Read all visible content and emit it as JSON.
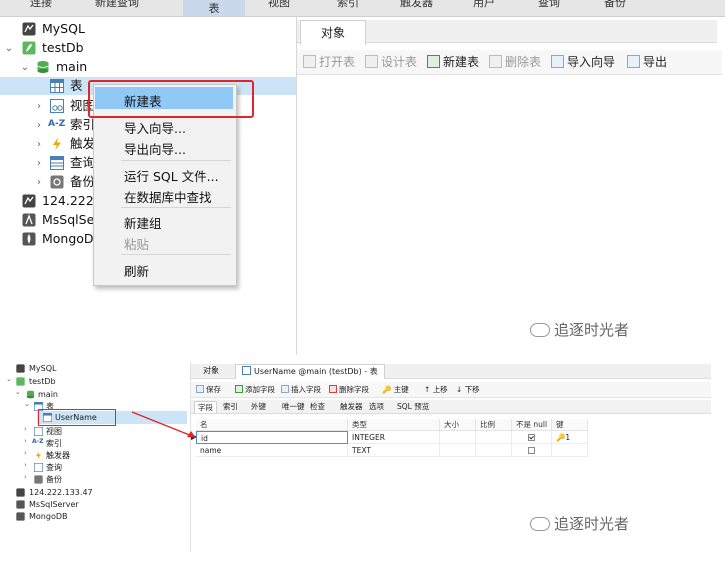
{
  "top": {
    "menubar": [
      "连接",
      "新建查询",
      "表",
      "视图",
      "索引",
      "触发器",
      "用户",
      "查询",
      "备份"
    ],
    "tree": {
      "mysql": "MySQL",
      "testdb": "testDb",
      "main": "main",
      "table": "表",
      "view": "视图",
      "index": "索引",
      "trigger": "触发",
      "query": "查询",
      "backup": "备份",
      "conn_ip": "124.222.1",
      "mssql": "MsSqlSer",
      "mongodb": "MongoDB"
    },
    "tab_objects": "对象",
    "toolbar": [
      "打开表",
      "设计表",
      "新建表",
      "删除表",
      "导入向导",
      "导出"
    ],
    "context_menu": {
      "new_table": "新建表",
      "import_wizard": "导入向导...",
      "export_wizard": "导出向导...",
      "run_sql": "运行 SQL 文件...",
      "find_in_db": "在数据库中查找",
      "new_group": "新建组",
      "paste": "粘贴",
      "refresh": "刷新"
    },
    "watermark": "追逐时光者"
  },
  "bottom": {
    "tree": {
      "mysql": "MySQL",
      "testdb": "testDb",
      "main": "main",
      "table": "表",
      "username": "UserName",
      "view": "视图",
      "index": "索引",
      "trigger": "触发器",
      "query": "查询",
      "backup": "备份",
      "conn_ip": "124.222.133.47",
      "mssql": "MsSqlServer",
      "mongodb": "MongoDB"
    },
    "tabs": {
      "objects": "对象",
      "design": "UserName @main (testDb) - 表"
    },
    "toolbar": [
      "保存",
      "添加字段",
      "插入字段",
      "删除字段",
      "主键",
      "上移",
      "下移"
    ],
    "subtabs": [
      "字段",
      "索引",
      "外键",
      "唯一键",
      "检查",
      "触发器",
      "选项",
      "SQL 预览"
    ],
    "grid": {
      "headers": [
        "名",
        "类型",
        "大小",
        "比例",
        "不是 null",
        "键"
      ],
      "rows": [
        {
          "name": "id",
          "type": "INTEGER",
          "size": "",
          "scale": "",
          "notnull": true,
          "key": "1"
        },
        {
          "name": "name",
          "type": "TEXT",
          "size": "",
          "scale": "",
          "notnull": false,
          "key": ""
        }
      ]
    },
    "watermark": "追逐时光者"
  }
}
